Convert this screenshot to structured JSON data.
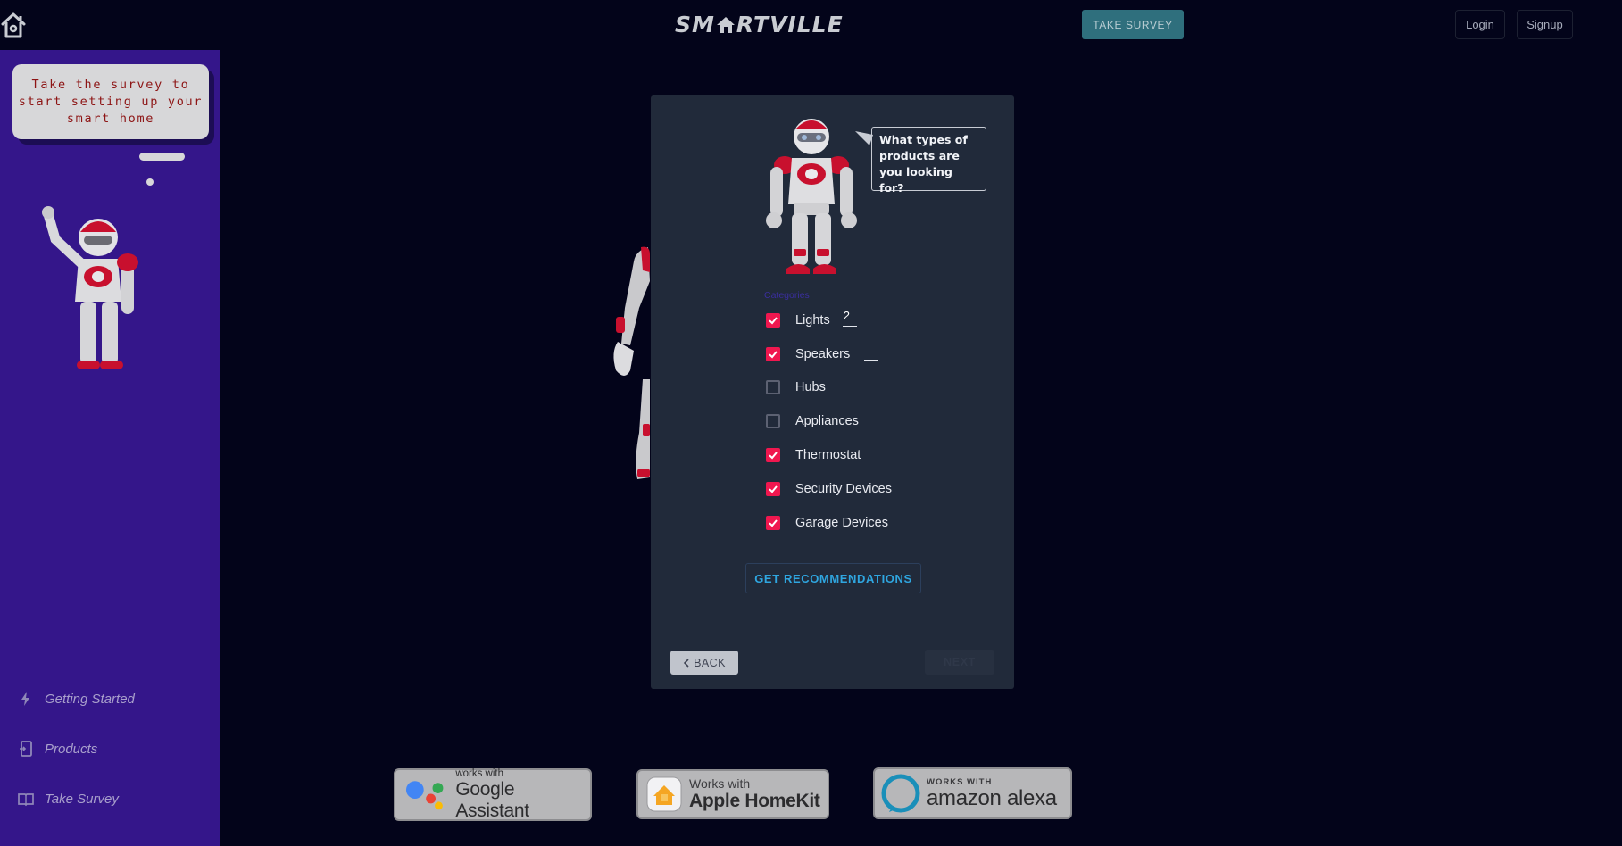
{
  "header": {
    "brand": "SMARTVILLE",
    "brand_left": "SM",
    "brand_right": "RTVILLE",
    "take_survey_label": "TAKE SURVEY",
    "login_label": "Login",
    "signup_label": "Signup",
    "home_icon": "home-icon"
  },
  "sidebar": {
    "bubble_text": "Take the survey to start setting up your smart home",
    "nav": [
      {
        "label": "Getting Started",
        "icon": "bolt-icon"
      },
      {
        "label": "Products",
        "icon": "device-icon"
      },
      {
        "label": "Take Survey",
        "icon": "book-icon"
      }
    ]
  },
  "modal": {
    "question": "What types of products are you looking for?",
    "categories_label": "Categories",
    "categories": [
      {
        "label": "Lights",
        "checked": true,
        "quantity": "2"
      },
      {
        "label": "Speakers",
        "checked": true,
        "quantity": ""
      },
      {
        "label": "Hubs",
        "checked": false
      },
      {
        "label": "Appliances",
        "checked": false
      },
      {
        "label": "Thermostat",
        "checked": true
      },
      {
        "label": "Security Devices",
        "checked": true
      },
      {
        "label": "Garage Devices",
        "checked": true
      }
    ],
    "get_recommendations_label": "GET RECOMMENDATIONS",
    "back_label": "BACK",
    "next_label": "NEXT"
  },
  "badges": {
    "google": {
      "small": "works with",
      "big": "Google Assistant"
    },
    "apple": {
      "small": "Works with",
      "big": "Apple HomeKit"
    },
    "alexa": {
      "small": "WORKS WITH",
      "big": "amazon alexa"
    }
  },
  "colors": {
    "background": "#03041a",
    "sidebar": "#34168a",
    "modal": "#212a3a",
    "checkbox_checked": "#f0174f",
    "survey_button": "#2f6f7d",
    "recommendations_text": "#2fa6e0",
    "bubble_text": "#8d1414"
  }
}
